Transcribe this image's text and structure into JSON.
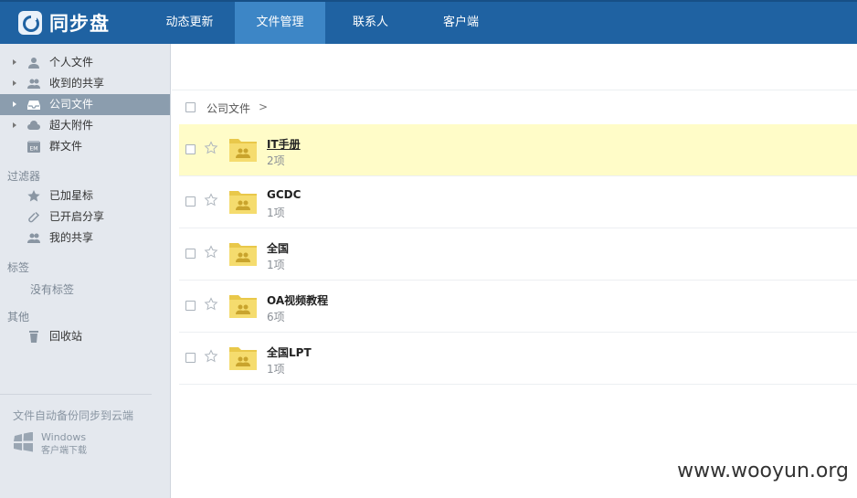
{
  "app": {
    "title": "同步盘"
  },
  "nav": [
    {
      "label": "动态更新",
      "active": false
    },
    {
      "label": "文件管理",
      "active": true
    },
    {
      "label": "联系人",
      "active": false
    },
    {
      "label": "客户端",
      "active": false
    }
  ],
  "sidebar": {
    "folders": [
      {
        "label": "个人文件",
        "icon": "user-icon",
        "expandable": true
      },
      {
        "label": "收到的共享",
        "icon": "users-icon",
        "expandable": true
      },
      {
        "label": "公司文件",
        "icon": "inbox-icon",
        "expandable": true,
        "active": true
      },
      {
        "label": "超大附件",
        "icon": "cloud-icon",
        "expandable": true
      },
      {
        "label": "群文件",
        "icon": "em-icon",
        "expandable": false
      }
    ],
    "filters_title": "过滤器",
    "filters": [
      {
        "label": "已加星标",
        "icon": "star-icon"
      },
      {
        "label": "已开启分享",
        "icon": "link-icon"
      },
      {
        "label": "我的共享",
        "icon": "users-icon"
      }
    ],
    "tags_title": "标签",
    "tags_empty": "没有标签",
    "other_title": "其他",
    "other": [
      {
        "label": "回收站",
        "icon": "trash-icon"
      }
    ],
    "backup_text": "文件自动备份同步到云端",
    "windows_title": "Windows",
    "windows_subtitle": "客户端下载"
  },
  "breadcrumb": {
    "current": "公司文件",
    "separator": ">"
  },
  "files": [
    {
      "name": "IT手册",
      "count": "2项",
      "highlighted": true
    },
    {
      "name": "GCDC",
      "count": "1项",
      "highlighted": false
    },
    {
      "name": "全国",
      "count": "1项",
      "highlighted": false
    },
    {
      "name": "OA视频教程",
      "count": "6项",
      "highlighted": false
    },
    {
      "name": "全国LPT",
      "count": "1项",
      "highlighted": false
    }
  ],
  "watermark": "www.wooyun.org",
  "colors": {
    "header": "#1f62a2",
    "nav_active": "#3d86c6",
    "sidebar": "#e4e8ee",
    "sidebar_active": "#8b9dae",
    "row_highlight": "#fffcc8"
  }
}
